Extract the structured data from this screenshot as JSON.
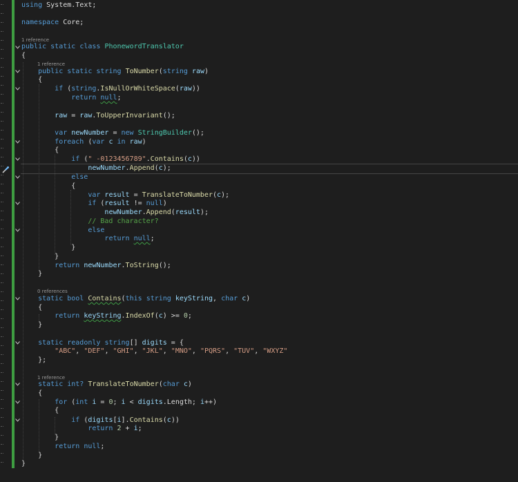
{
  "editor": {
    "colors": {
      "background": "#1e1e1e",
      "change_bar": "#3e9d41",
      "keyword": "#569cd6",
      "type": "#4ec9b0",
      "method": "#dcdcaa",
      "string": "#d69d85",
      "comment": "#57a64a",
      "text": "#dcdcdc"
    },
    "icons": {
      "fold": "chevron-down-icon",
      "quick_action": "screwdriver-icon"
    },
    "codelens": {
      "class_refs": "1 reference",
      "tonumber_refs": "1 reference",
      "contains_refs": "0 references",
      "translate_refs": "1 reference"
    },
    "tokens": {
      "using": "using",
      "system_text": " System.Text;",
      "namespace": "namespace",
      "core": " Core;",
      "public": "public",
      "static": "static",
      "class": "class",
      "string": "string",
      "bool": "bool",
      "int": "int",
      "int_q": "int?",
      "readonly": "readonly",
      "return": "return",
      "null": "null",
      "if": "if",
      "else": "else",
      "var": "var",
      "new": "new",
      "foreach": "foreach",
      "in": "in",
      "for": "for",
      "this": "this",
      "char": "char",
      "PhonewordTranslator": "PhonewordTranslator",
      "ToNumber": "ToNumber",
      "IsNullOrWhiteSpace": "IsNullOrWhiteSpace",
      "ToUpperInvariant": "ToUpperInvariant",
      "StringBuilder": "StringBuilder",
      "Contains": "Contains",
      "Append": "Append",
      "TranslateToNumber": "TranslateToNumber",
      "ToString": "ToString",
      "IndexOf": "IndexOf",
      "raw": "raw",
      "newNumber": "newNumber",
      "c": "c",
      "result": "result",
      "keyString": "keyString",
      "i": "i",
      "digits": "digits",
      "zero": "0",
      "two": "2",
      "digits_str": "\" -0123456789\"",
      "comment_bad": "// Bad character?",
      "abc": "\"ABC\"",
      "def": "\"DEF\"",
      "ghi": "\"GHI\"",
      "jkl": "\"JKL\"",
      "mno": "\"MNO\"",
      "pqrs": "\"PQRS\"",
      "tuv": "\"TUV\"",
      "wxyz": "\"WXYZ\""
    }
  }
}
